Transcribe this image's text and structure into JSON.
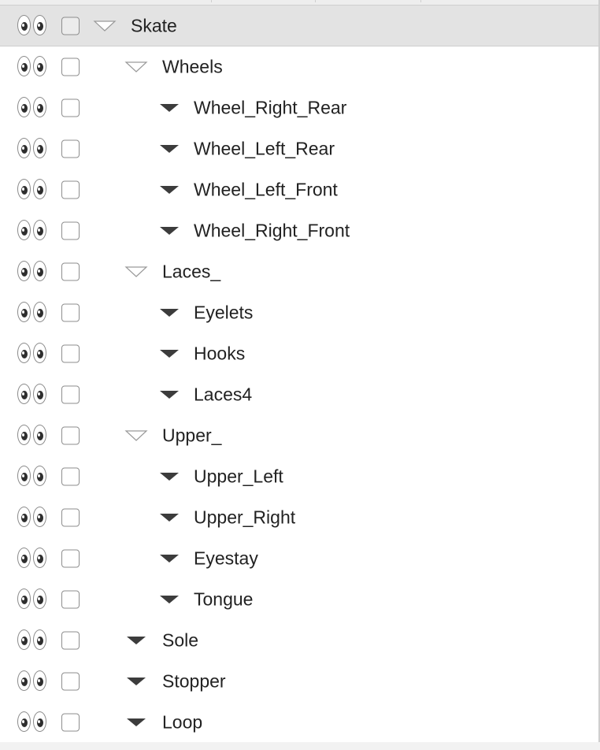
{
  "root": {
    "label": "Skate",
    "expanded": true
  },
  "items": [
    {
      "label": "Wheels",
      "level": 1,
      "state": "open-group"
    },
    {
      "label": "Wheel_Right_Rear",
      "level": 2,
      "state": "leaf"
    },
    {
      "label": "Wheel_Left_Rear",
      "level": 2,
      "state": "leaf"
    },
    {
      "label": "Wheel_Left_Front",
      "level": 2,
      "state": "leaf"
    },
    {
      "label": "Wheel_Right_Front",
      "level": 2,
      "state": "leaf"
    },
    {
      "label": "Laces_",
      "level": 1,
      "state": "open-group"
    },
    {
      "label": "Eyelets",
      "level": 2,
      "state": "leaf"
    },
    {
      "label": "Hooks",
      "level": 2,
      "state": "leaf"
    },
    {
      "label": "Laces4",
      "level": 2,
      "state": "leaf"
    },
    {
      "label": "Upper_",
      "level": 1,
      "state": "open-group"
    },
    {
      "label": "Upper_Left",
      "level": 2,
      "state": "leaf"
    },
    {
      "label": "Upper_Right",
      "level": 2,
      "state": "leaf"
    },
    {
      "label": "Eyestay",
      "level": 2,
      "state": "leaf"
    },
    {
      "label": "Tongue",
      "level": 2,
      "state": "leaf"
    },
    {
      "label": "Sole",
      "level": 1,
      "state": "leaf"
    },
    {
      "label": "Stopper",
      "level": 1,
      "state": "leaf"
    },
    {
      "label": "Loop",
      "level": 1,
      "state": "leaf"
    }
  ],
  "icons": {
    "visibility": "eyes-icon",
    "select": "checkbox",
    "expanded_group": "disclosure-open-outline-icon",
    "leaf": "disclosure-filled-icon"
  },
  "colors": {
    "header_bg": "#e3e3e3",
    "text": "#222222",
    "triangle_fill": "#3c3c3c",
    "triangle_outline": "#9a9a9a"
  }
}
